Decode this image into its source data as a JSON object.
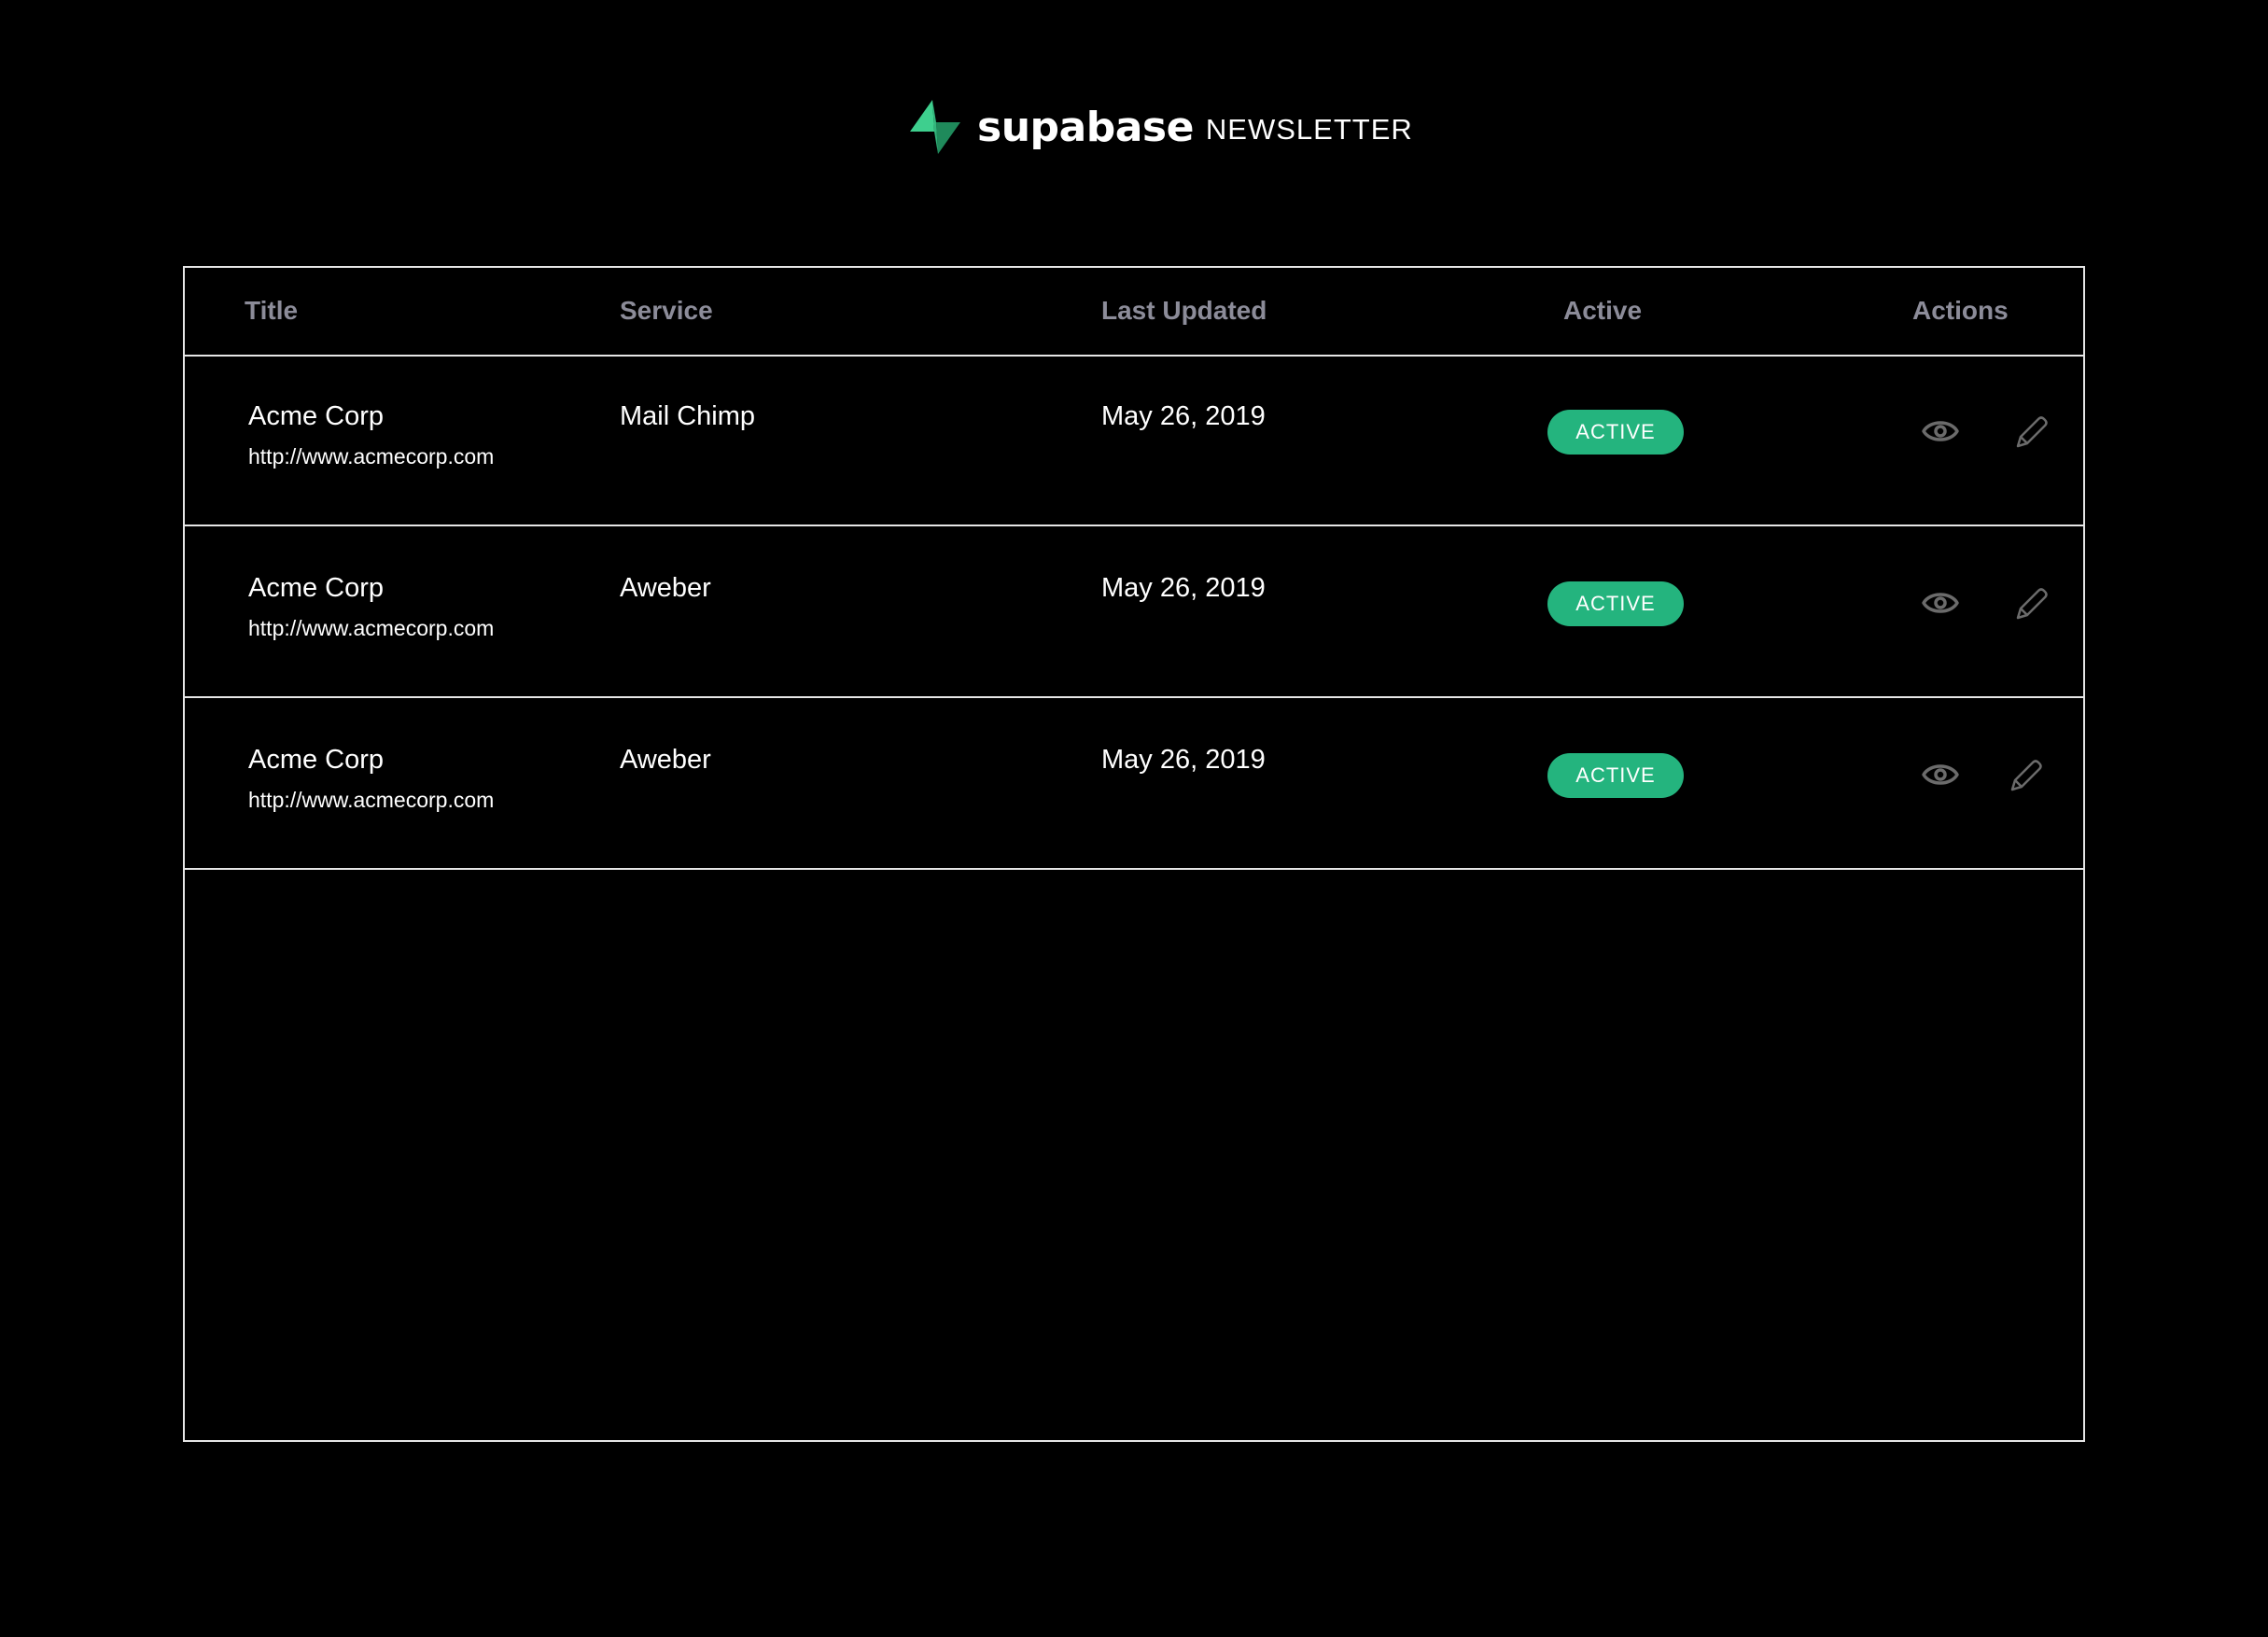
{
  "brand": {
    "name": "supabase",
    "product": "NEWSLETTER",
    "logo_icon": "supabase-bolt-icon",
    "accent_color": "#3ecf8e"
  },
  "table": {
    "headers": {
      "title": "Title",
      "service": "Service",
      "last_updated": "Last Updated",
      "active": "Active",
      "actions": "Actions"
    },
    "rows": [
      {
        "title": "Acme Corp",
        "url": "http://www.acmecorp.com",
        "service": "Mail Chimp",
        "last_updated": "May 26, 2019",
        "status": "ACTIVE",
        "actions": [
          "eye-icon",
          "pencil-icon"
        ]
      },
      {
        "title": "Acme Corp",
        "url": "http://www.acmecorp.com",
        "service": "Aweber",
        "last_updated": "May 26, 2019",
        "status": "ACTIVE",
        "actions": [
          "eye-icon",
          "pencil-icon"
        ]
      },
      {
        "title": "Acme Corp",
        "url": "http://www.acmecorp.com",
        "service": "Aweber",
        "last_updated": "May 26, 2019",
        "status": "ACTIVE",
        "actions": [
          "eye-icon",
          "pencil-icon"
        ]
      }
    ]
  },
  "colors": {
    "background": "#000000",
    "border": "#e6e6e6",
    "header_text": "#8c8c99",
    "status_active": "#24b47e",
    "icon": "#6b6b6b"
  }
}
